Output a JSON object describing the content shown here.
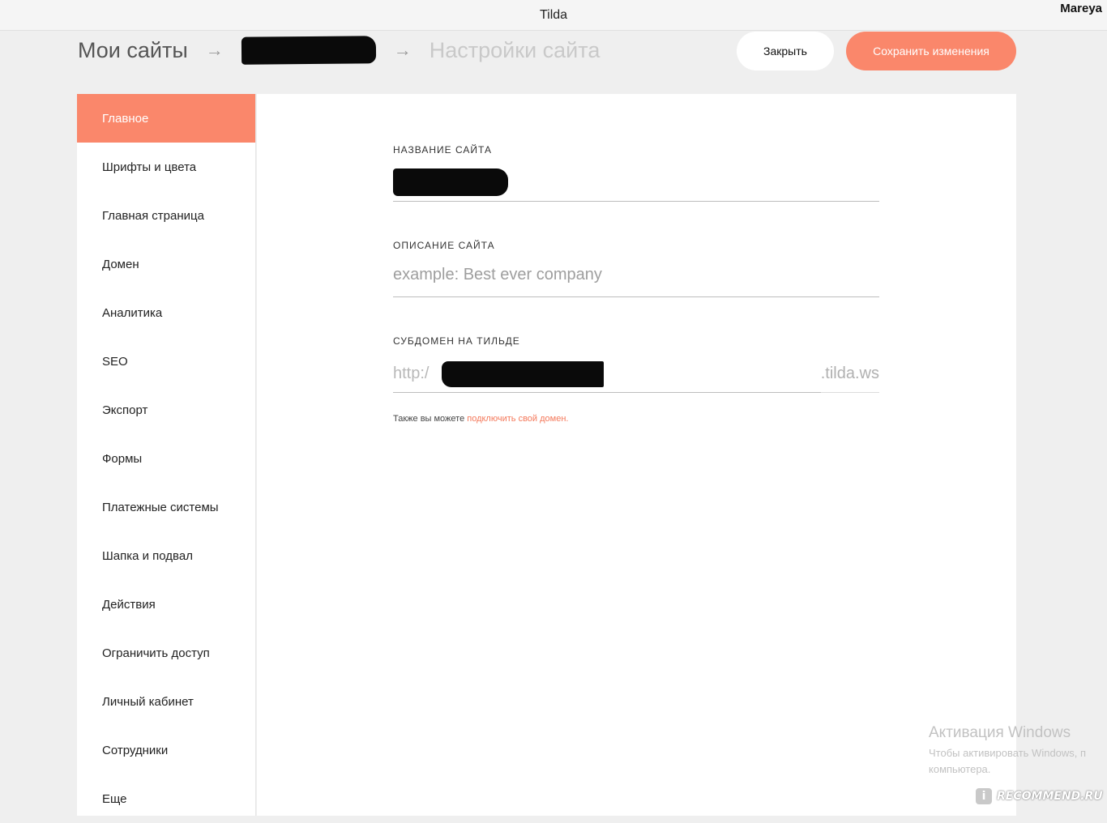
{
  "window": {
    "title": "Tilda",
    "user": "Mareya"
  },
  "breadcrumbs": {
    "root": "Мои сайты",
    "arrow": "→",
    "current": "Настройки сайта"
  },
  "actions": {
    "close_label": "Закрыть",
    "save_label": "Сохранить изменения"
  },
  "colors": {
    "accent": "#fa876b",
    "link": "#f4785a"
  },
  "sidebar": {
    "active_index": 0,
    "items": [
      {
        "label": "Главное"
      },
      {
        "label": "Шрифты и цвета"
      },
      {
        "label": "Главная страница"
      },
      {
        "label": "Домен"
      },
      {
        "label": "Аналитика"
      },
      {
        "label": "SEO"
      },
      {
        "label": "Экспорт"
      },
      {
        "label": "Формы"
      },
      {
        "label": "Платежные системы"
      },
      {
        "label": "Шапка и подвал"
      },
      {
        "label": "Действия"
      },
      {
        "label": "Ограничить доступ"
      },
      {
        "label": "Личный кабинет"
      },
      {
        "label": "Сотрудники"
      },
      {
        "label": "Еще"
      }
    ]
  },
  "form": {
    "site_name": {
      "label": "НАЗВАНИЕ САЙТА"
    },
    "description": {
      "label": "ОПИСАНИЕ САЙТА",
      "placeholder": "example: Best ever company"
    },
    "subdomain": {
      "label": "СУБДОМЕН НА ТИЛЬДЕ",
      "prefix": "http:/",
      "suffix": ".tilda.ws"
    },
    "hint_text": "Также вы можете ",
    "hint_link": "подключить свой домен."
  },
  "watermark": {
    "line1": "Активация Windows",
    "line2": "Чтобы активировать Windows, п",
    "line3": "компьютера."
  },
  "logo": {
    "mark": "i",
    "text": "RECOMMEND.RU"
  }
}
